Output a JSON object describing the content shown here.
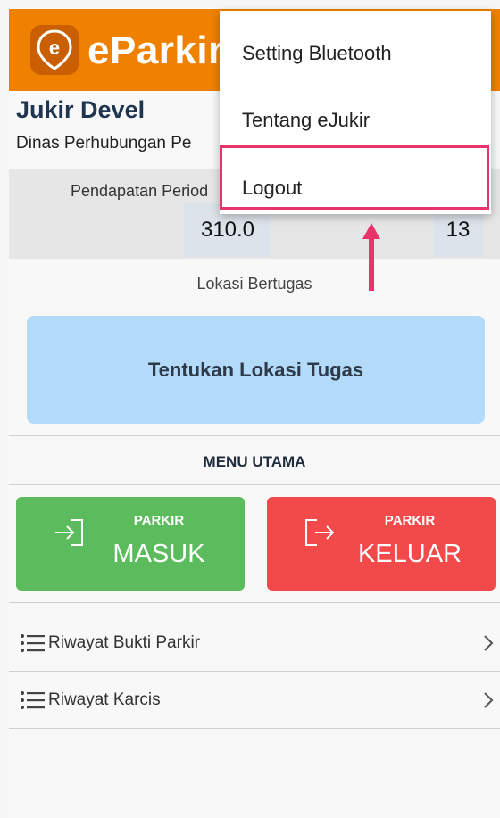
{
  "header": {
    "app_title": "eParkir",
    "logo_icon": "location-pin-e-icon",
    "color": "#f08000"
  },
  "profile": {
    "name": "Jukir Devel",
    "organization": "Dinas Perhubungan Pe"
  },
  "income": {
    "label": "Pendapatan Period",
    "amount": "310.0",
    "count": "13"
  },
  "location": {
    "label": "Lokasi Bertugas",
    "button_label": "Tentukan Lokasi Tugas"
  },
  "menu": {
    "title": "MENU UTAMA",
    "parkir_masuk": {
      "small": "PARKIR",
      "big": "MASUK",
      "icon": "login-icon",
      "color": "#5cbb5c"
    },
    "parkir_keluar": {
      "small": "PARKIR",
      "big": "KELUAR",
      "icon": "logout-icon",
      "color": "#f24a4a"
    }
  },
  "list": [
    {
      "label": "Riwayat Bukti Parkir",
      "icon": "list-icon"
    },
    {
      "label": "Riwayat Karcis",
      "icon": "list-icon"
    }
  ],
  "popup": {
    "items": [
      {
        "label": "Setting Bluetooth"
      },
      {
        "label": "Tentang eJukir"
      },
      {
        "label": "Logout"
      }
    ],
    "highlight_color": "#e8336b"
  }
}
